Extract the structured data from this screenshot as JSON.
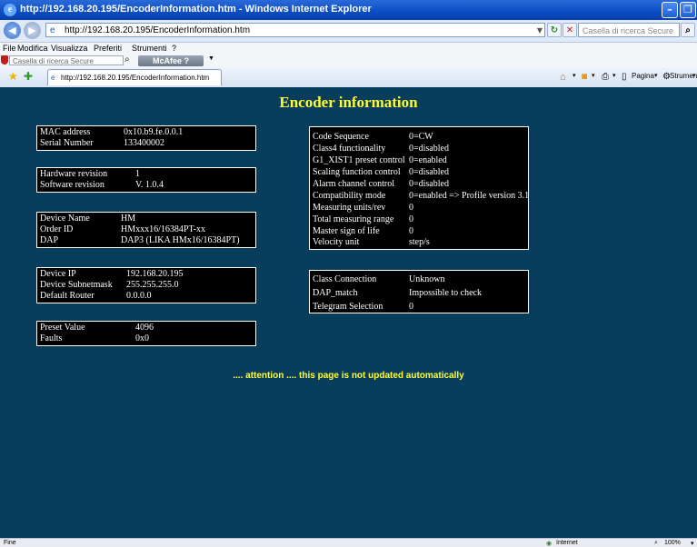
{
  "window": {
    "title": "http://192.168.20.195/EncoderInformation.htm - Windows Internet Explorer",
    "minimize_glyph": "–",
    "maximize_glyph": "❐"
  },
  "addressbar": {
    "url": "http://192.168.20.195/EncoderInformation.htm",
    "search_placeholder": "Casella di ricerca Secure"
  },
  "menu": {
    "items": [
      "File",
      "Modifica",
      "Visualizza",
      "Preferiti",
      "Strumenti",
      "?"
    ]
  },
  "mcafee": {
    "search_placeholder": "Casella di ricerca Secure",
    "brand_label": "McAfee"
  },
  "tab": {
    "label": "http://192.168.20.195/EncoderInformation.htm"
  },
  "commandbar": {
    "pagina_label": "Pagina",
    "strumenti_label": "Strumenti"
  },
  "page": {
    "title": "Encoder information",
    "attention": ".... attention .... this page is not updated automatically",
    "left_boxes": [
      {
        "rows": [
          {
            "label": "MAC address",
            "value": "0x10.b9.fe.0.0.1"
          },
          {
            "label": "Serial Number",
            "value": "133400002"
          }
        ]
      },
      {
        "rows": [
          {
            "label": "Hardware revision",
            "value": "1"
          },
          {
            "label": "Software revision",
            "value": "V. 1.0.4"
          }
        ]
      },
      {
        "rows": [
          {
            "label": "Device Name",
            "value": "HM"
          },
          {
            "label": "Order ID",
            "value": "HMxxx16/16384PT-xx"
          },
          {
            "label": "DAP",
            "value": "DAP3 (LIKA HMx16/16384PT)"
          }
        ]
      },
      {
        "rows": [
          {
            "label": "Device IP",
            "value": "192.168.20.195"
          },
          {
            "label": "Device Subnetmask",
            "value": "255.255.255.0"
          },
          {
            "label": "Default Router",
            "value": "0.0.0.0"
          }
        ]
      },
      {
        "rows": [
          {
            "label": "Preset Value",
            "value": "4096"
          },
          {
            "label": "Faults",
            "value": "0x0"
          }
        ]
      }
    ],
    "right_boxes": [
      {
        "rows": [
          {
            "label": "Code Sequence",
            "value": "0=CW"
          },
          {
            "label": "Class4 functionality",
            "value": "0=disabled"
          },
          {
            "label": "G1_XIST1 preset control",
            "value": "0=enabled"
          },
          {
            "label": "Scaling function control",
            "value": "0=disabled"
          },
          {
            "label": "Alarm channel control",
            "value": "0=disabled"
          },
          {
            "label": "Compatibility mode",
            "value": "0=enabled => Profile version 3.1"
          },
          {
            "label": "Measuring units/rev",
            "value": "0"
          },
          {
            "label": "Total measuring range",
            "value": "0"
          },
          {
            "label": "Master sign of life",
            "value": "0"
          },
          {
            "label": "Velocity unit",
            "value": "step/s"
          }
        ]
      },
      {
        "rows": [
          {
            "label": "Class Connection",
            "value": "Unknown"
          },
          {
            "label": "DAP_match",
            "value": "Impossible to check"
          },
          {
            "label": "Telegram Selection",
            "value": "0"
          }
        ]
      }
    ]
  },
  "statusbar": {
    "left": "Fine",
    "zone": "Internet",
    "zoom": "100%"
  }
}
